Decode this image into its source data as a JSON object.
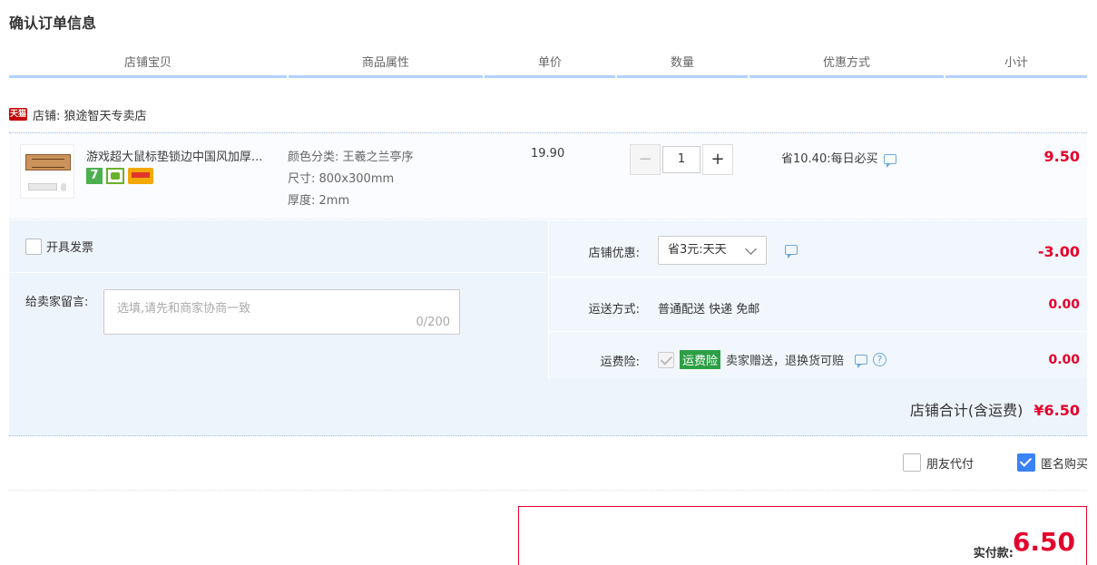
{
  "page_title": "确认订单信息",
  "headers": [
    "店铺宝贝",
    "商品属性",
    "单价",
    "数量",
    "优惠方式",
    "小计"
  ],
  "shop": {
    "badge": "天猫",
    "label": "店铺: 狼途智天专卖店"
  },
  "item": {
    "title": "游戏超大鼠标垫锁边中国风加厚...",
    "icon_badge": "7",
    "props": [
      "颜色分类: 王羲之兰亭序",
      "尺寸: 800x300mm",
      "厚度: 2mm"
    ],
    "unit_price": "19.90",
    "quantity": "1",
    "minus": "−",
    "plus": "+",
    "promo": "省10.40:每日必买",
    "subtotal": "9.50"
  },
  "invoice_label": "开具发票",
  "message": {
    "label": "给卖家留言:",
    "placeholder": "选填,请先和商家协商一致",
    "counter": "0/200"
  },
  "shop_discount": {
    "label": "店铺优惠:",
    "selected": "省3元:天天",
    "amount": "-3.00"
  },
  "shipping": {
    "label": "运送方式:",
    "value": "普通配送 快递 免邮",
    "amount": "0.00"
  },
  "insurance": {
    "label": "运费险:",
    "tag": "运费险",
    "text": "卖家赠送，退换货可赔",
    "help": "?",
    "amount": "0.00"
  },
  "shop_total": {
    "label": "店铺合计(含运费)",
    "amount": "¥6.50"
  },
  "friend_pay": "朋友代付",
  "anonymous": "匿名购买",
  "payment": {
    "label": "实付款:",
    "amount": "6.50"
  },
  "colors": {
    "accent_red": "#e4002b",
    "header_line": "#b2d1ff",
    "panel_bg": "#eef4fc",
    "checkbox_blue": "#3a82f7"
  }
}
